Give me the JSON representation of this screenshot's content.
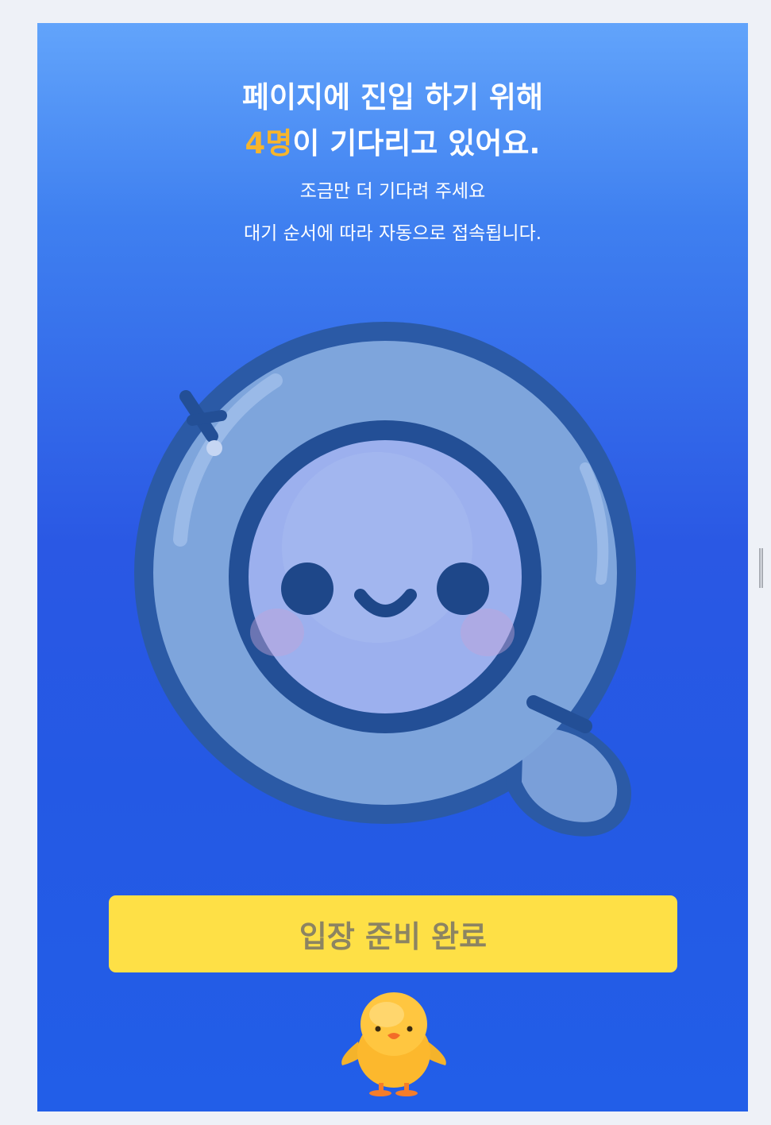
{
  "queue": {
    "headline_line1": "페이지에 진입 하기 위해",
    "waiting_count": "4명",
    "headline_line2_suffix": "이 기다리고 있어요.",
    "subtitle": "조금만 더 기다려 주세요",
    "notice": "대기 순서에 따라 자동으로 접속됩니다."
  },
  "illustration": {
    "mascot_icon": "q-smiley-mascot-icon",
    "chick_icon": "yellow-chick-icon"
  },
  "actions": {
    "enter_label": "입장 준비 완료"
  },
  "colors": {
    "gradient_top": "#62a4fb",
    "gradient_bottom": "#225ee8",
    "count_highlight": "#f7b52c",
    "button_bg": "#fee046",
    "button_text": "#8c8462"
  }
}
